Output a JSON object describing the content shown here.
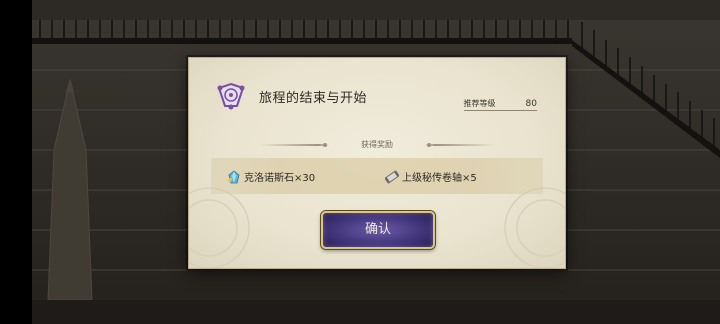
{
  "dialog": {
    "title": "旅程的结束与开始",
    "level_label": "推荐等级",
    "level_value": "80",
    "rewards_label": "获得奖励",
    "rewards": [
      {
        "name": "克洛诺斯石×30",
        "icon": "kronos-stone-icon"
      },
      {
        "name": "上级秘传卷轴×5",
        "icon": "scroll-icon"
      }
    ],
    "confirm_label": "确认"
  },
  "colors": {
    "dialog_bg": "#ebe5d2",
    "button_bg": "#3d3075",
    "button_border": "#d9c58a",
    "emblem": "#7a4f9e"
  }
}
